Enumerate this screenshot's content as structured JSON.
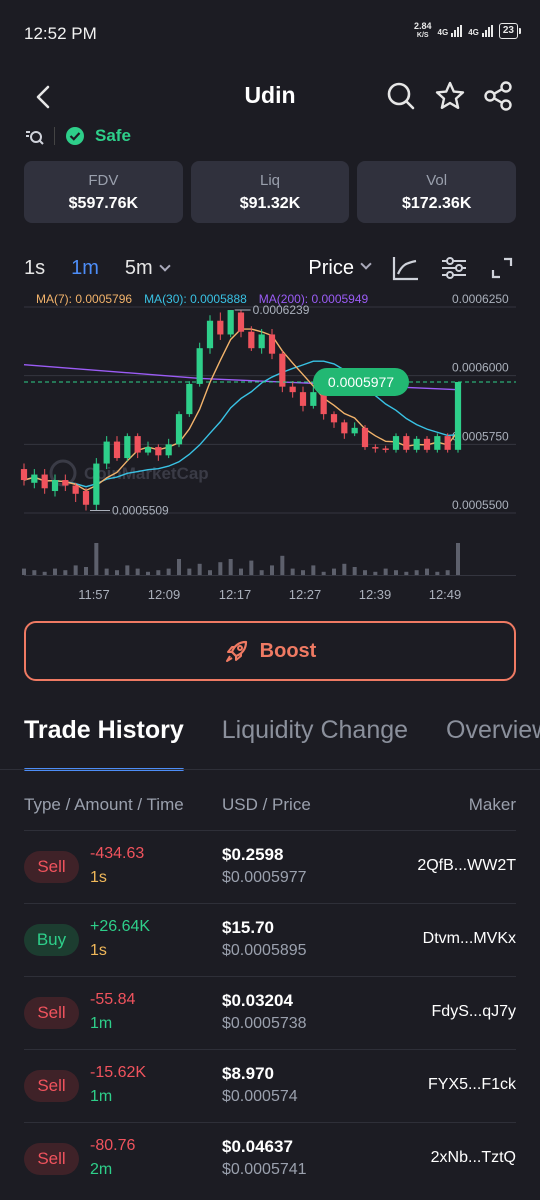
{
  "status": {
    "time": "12:52 PM",
    "net_speed": "2.84",
    "net_unit": "K/S",
    "sim1": "4G",
    "sim2": "4G",
    "battery": "23"
  },
  "header": {
    "title": "Udin"
  },
  "safety": {
    "label": "Safe"
  },
  "stats": [
    {
      "label": "FDV",
      "value": "$597.76K"
    },
    {
      "label": "Liq",
      "value": "$91.32K"
    },
    {
      "label": "Vol",
      "value": "$172.36K"
    }
  ],
  "chart_controls": {
    "intervals": [
      "1s",
      "1m",
      "5m"
    ],
    "active_interval": "1m",
    "price_mode": "Price"
  },
  "chart_data": {
    "type": "candlestick",
    "ma": [
      {
        "label": "MA(7): 0.0005796",
        "color": "#f2b36b"
      },
      {
        "label": "MA(30): 0.0005888",
        "color": "#39c2e4"
      },
      {
        "label": "MA(200): 0.0005949",
        "color": "#9b5cf5"
      }
    ],
    "y_ticks": [
      "0.0006250",
      "0.0006000",
      "0.0005750",
      "0.0005500"
    ],
    "y_tick_values": [
      0.000625,
      0.0006,
      0.000575,
      0.00055
    ],
    "x_ticks": [
      "11:57",
      "12:09",
      "12:17",
      "12:27",
      "12:39",
      "12:49"
    ],
    "high_label": "0.0006239",
    "low_label": "0.0005509",
    "current_price": "0.0005977",
    "watermark": "CoinMarketCap",
    "candles": [
      [
        0.000566,
        0.000562,
        0.000568,
        0.00056
      ],
      [
        0.000561,
        0.000564,
        0.000566,
        0.000559
      ],
      [
        0.000564,
        0.000559,
        0.000566,
        0.000557
      ],
      [
        0.000558,
        0.000562,
        0.000564,
        0.000556
      ],
      [
        0.000562,
        0.00056,
        0.000564,
        0.000558
      ],
      [
        0.00056,
        0.000557,
        0.000561,
        0.000554
      ],
      [
        0.000558,
        0.000553,
        0.000559,
        0.0005509
      ],
      [
        0.000553,
        0.000568,
        0.00057,
        0.000551
      ],
      [
        0.000568,
        0.000576,
        0.000578,
        0.000566
      ],
      [
        0.000576,
        0.00057,
        0.000578,
        0.000569
      ],
      [
        0.00057,
        0.000578,
        0.000579,
        0.000569
      ],
      [
        0.000578,
        0.000572,
        0.000579,
        0.00057
      ],
      [
        0.000572,
        0.000574,
        0.000576,
        0.000571
      ],
      [
        0.000574,
        0.000571,
        0.000575,
        0.000569
      ],
      [
        0.000571,
        0.000575,
        0.000577,
        0.00057
      ],
      [
        0.000575,
        0.000586,
        0.000587,
        0.000574
      ],
      [
        0.000586,
        0.000597,
        0.000598,
        0.000585
      ],
      [
        0.000597,
        0.00061,
        0.000612,
        0.000596
      ],
      [
        0.00061,
        0.00062,
        0.000622,
        0.000608
      ],
      [
        0.00062,
        0.000615,
        0.000623,
        0.000613
      ],
      [
        0.000615,
        0.0006239,
        0.0006239,
        0.000614
      ],
      [
        0.000623,
        0.000616,
        0.0006239,
        0.000614
      ],
      [
        0.000616,
        0.00061,
        0.000618,
        0.000609
      ],
      [
        0.00061,
        0.000615,
        0.000617,
        0.000608
      ],
      [
        0.000615,
        0.000608,
        0.000617,
        0.000606
      ],
      [
        0.000608,
        0.000596,
        0.000609,
        0.000594
      ],
      [
        0.000596,
        0.000594,
        0.000598,
        0.000592
      ],
      [
        0.000594,
        0.000589,
        0.000596,
        0.000587
      ],
      [
        0.000589,
        0.000594,
        0.000596,
        0.000588
      ],
      [
        0.000594,
        0.000586,
        0.000595,
        0.000584
      ],
      [
        0.000586,
        0.000583,
        0.000587,
        0.000581
      ],
      [
        0.000583,
        0.000579,
        0.000584,
        0.000577
      ],
      [
        0.000579,
        0.000581,
        0.000583,
        0.000578
      ],
      [
        0.000581,
        0.000574,
        0.000582,
        0.000573
      ],
      [
        0.000574,
        0.0005735,
        0.000575,
        0.000572
      ],
      [
        0.0005735,
        0.000573,
        0.0005745,
        0.000572
      ],
      [
        0.000573,
        0.000578,
        0.000579,
        0.000572
      ],
      [
        0.000578,
        0.000573,
        0.000579,
        0.000572
      ],
      [
        0.000573,
        0.000577,
        0.000578,
        0.000572
      ],
      [
        0.000577,
        0.000573,
        0.000578,
        0.000572
      ],
      [
        0.000573,
        0.000578,
        0.000579,
        0.000572
      ],
      [
        0.000578,
        0.000573,
        0.000579,
        0.000572
      ],
      [
        0.000573,
        0.0005977,
        0.0005977,
        0.000572
      ]
    ],
    "volume": [
      0.2,
      0.15,
      0.1,
      0.2,
      0.15,
      0.3,
      0.25,
      1.0,
      0.2,
      0.15,
      0.3,
      0.2,
      0.1,
      0.15,
      0.2,
      0.5,
      0.2,
      0.35,
      0.15,
      0.4,
      0.5,
      0.2,
      0.45,
      0.15,
      0.3,
      0.6,
      0.2,
      0.15,
      0.3,
      0.1,
      0.2,
      0.35,
      0.25,
      0.15,
      0.1,
      0.2,
      0.15,
      0.1,
      0.15,
      0.2,
      0.1,
      0.15,
      1.0
    ]
  },
  "boost": {
    "label": "Boost"
  },
  "tabs": [
    "Trade History",
    "Liquidity Change",
    "Overview"
  ],
  "trade_table": {
    "headers": {
      "type": "Type / Amount / Time",
      "usd": "USD / Price",
      "maker": "Maker"
    },
    "rows": [
      {
        "type": "Sell",
        "amount": "-434.63",
        "age": "1s",
        "usd": "$0.2598",
        "price": "$0.0005977",
        "maker": "2QfB...WW2T"
      },
      {
        "type": "Buy",
        "amount": "+26.64K",
        "age": "1s",
        "usd": "$15.70",
        "price": "$0.0005895",
        "maker": "Dtvm...MVKx"
      },
      {
        "type": "Sell",
        "amount": "-55.84",
        "age": "1m",
        "usd": "$0.03204",
        "price": "$0.0005738",
        "maker": "FdyS...qJ7y"
      },
      {
        "type": "Sell",
        "amount": "-15.62K",
        "age": "1m",
        "usd": "$8.970",
        "price": "$0.000574",
        "maker": "FYX5...F1ck"
      },
      {
        "type": "Sell",
        "amount": "-80.76",
        "age": "2m",
        "usd": "$0.04637",
        "price": "$0.0005741",
        "maker": "2xNb...TztQ"
      }
    ]
  }
}
